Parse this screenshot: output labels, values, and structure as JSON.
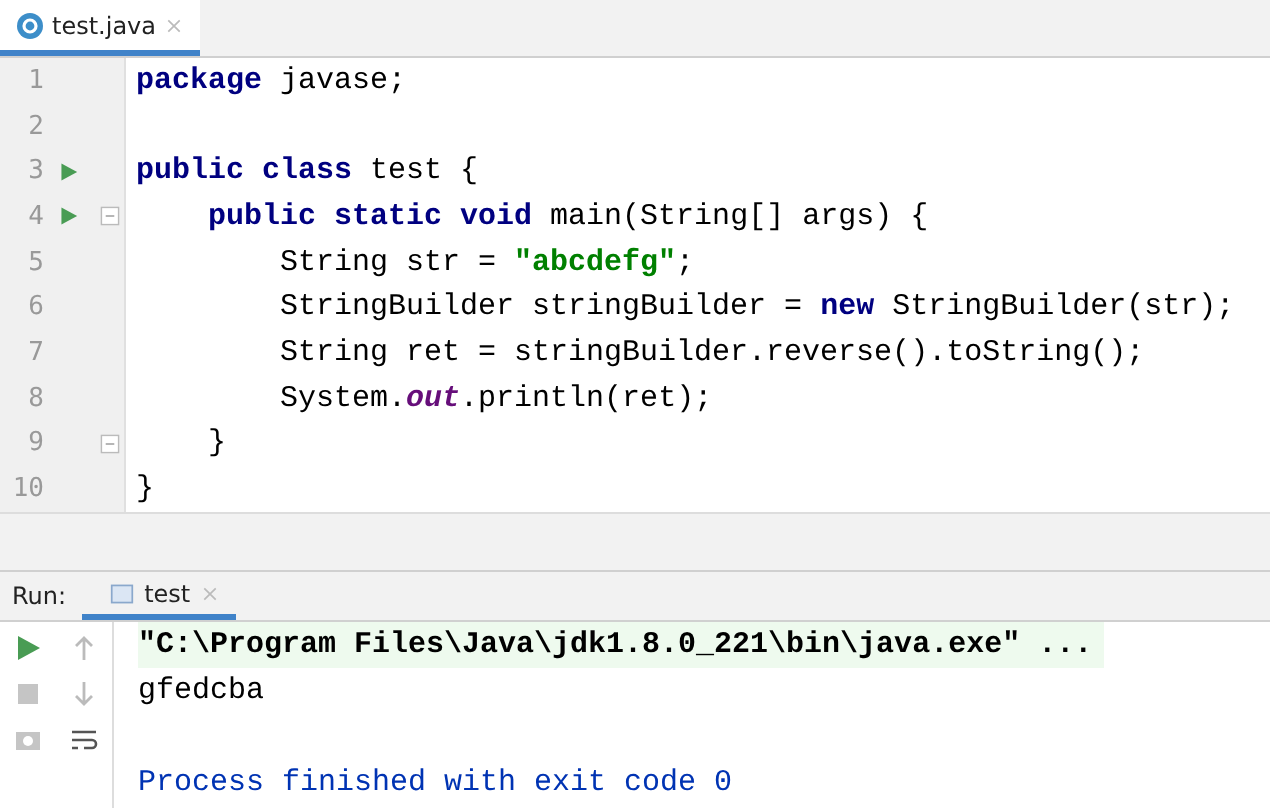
{
  "editor_tabs": [
    {
      "label": "test.java",
      "selected": true
    }
  ],
  "code_lines": [
    {
      "number": "1",
      "run": false,
      "fold": false,
      "tokens": [
        {
          "kind": "keyword",
          "text": "package"
        },
        {
          "kind": "plain",
          "text": " javase;"
        }
      ]
    },
    {
      "number": "2",
      "run": false,
      "fold": false
    },
    {
      "number": "3",
      "run": true,
      "fold": false,
      "tokens": [
        {
          "kind": "keyword",
          "text": "public class"
        },
        {
          "kind": "plain",
          "text": " test {"
        }
      ]
    },
    {
      "number": "4",
      "run": true,
      "fold": true,
      "tokens": [
        {
          "kind": "keyword",
          "text": "    public static void"
        },
        {
          "kind": "plain",
          "text": " main(String[] args) {"
        }
      ]
    },
    {
      "number": "5",
      "run": false,
      "fold": false,
      "tokens": [
        {
          "kind": "plain",
          "text": "        String str = "
        },
        {
          "kind": "string",
          "text": "\"abcdefg\""
        },
        {
          "kind": "plain",
          "text": ";"
        }
      ]
    },
    {
      "number": "6",
      "run": false,
      "fold": false,
      "tokens": [
        {
          "kind": "plain",
          "text": "        StringBuilder stringBuilder = "
        },
        {
          "kind": "keyword",
          "text": "new"
        },
        {
          "kind": "plain",
          "text": " StringBuilder(str);"
        }
      ]
    },
    {
      "number": "7",
      "run": false,
      "fold": false,
      "tokens": [
        {
          "kind": "plain",
          "text": "        String ret = stringBuilder.reverse().toString();"
        }
      ]
    },
    {
      "number": "8",
      "run": false,
      "fold": false,
      "tokens": [
        {
          "kind": "plain",
          "text": "        System."
        },
        {
          "kind": "field",
          "text": "out"
        },
        {
          "kind": "plain",
          "text": ".println(ret);"
        }
      ]
    },
    {
      "number": "9",
      "run": false,
      "fold": true,
      "tokens": [
        {
          "kind": "plain",
          "text": "    }"
        }
      ]
    },
    {
      "number": "10",
      "run": false,
      "fold": false,
      "tokens": [
        {
          "kind": "plain",
          "text": "}"
        }
      ]
    }
  ],
  "run_panel": {
    "label": "Run:",
    "tabs": [
      {
        "label": "test",
        "selected": true
      }
    ],
    "console_lines": [
      {
        "kind": "command",
        "text": "\"C:\\Program Files\\Java\\jdk1.8.0_221\\bin\\java.exe\" ..."
      },
      {
        "kind": "output",
        "text": "gfedcba"
      },
      {
        "kind": "blank"
      },
      {
        "kind": "system",
        "text": "Process finished with exit code 0"
      }
    ]
  }
}
